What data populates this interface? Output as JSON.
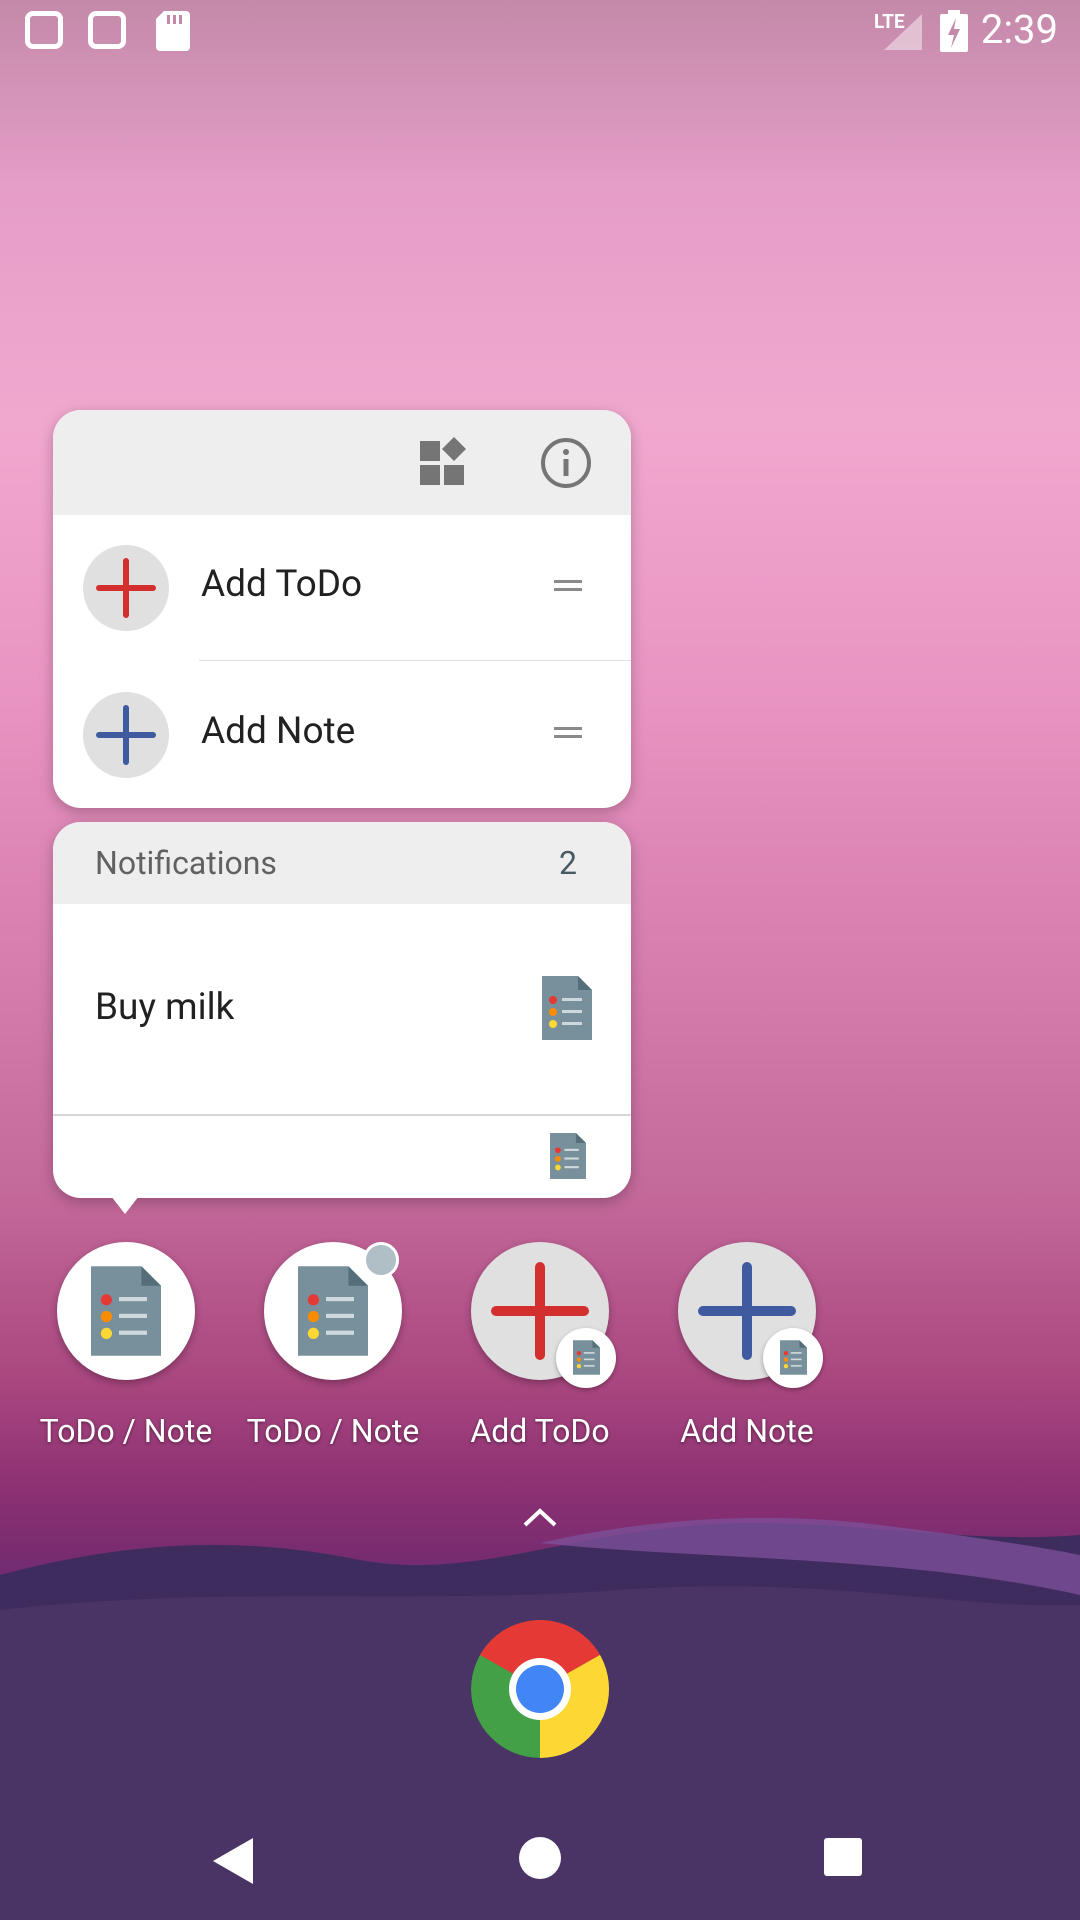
{
  "status_bar": {
    "time": "2:39",
    "network": "LTE",
    "left_icons": [
      "square-notification-icon",
      "square-notification-icon",
      "sd-card-icon"
    ],
    "right_icons": [
      "lte-signal-icon",
      "battery-charging-icon"
    ]
  },
  "shortcuts_popup": {
    "header_icons": [
      "widgets-icon",
      "app-info-icon"
    ],
    "items": [
      {
        "label": "Add ToDo",
        "icon": "plus-icon",
        "color": "#d32f2f"
      },
      {
        "label": "Add Note",
        "icon": "plus-icon",
        "color": "#3f5a9e"
      }
    ]
  },
  "notifications": {
    "title": "Notifications",
    "count": "2",
    "items": [
      {
        "text": "Buy milk",
        "icon": "todo-note-icon"
      }
    ],
    "footer_icon": "todo-note-icon"
  },
  "home_apps": [
    {
      "label": "ToDo / Note",
      "icon": "todo-note-icon"
    },
    {
      "label": "ToDo / Note",
      "icon": "todo-note-icon",
      "badge": "notification-dot"
    },
    {
      "label": "Add ToDo",
      "icon": "plus-icon",
      "color": "#d32f2f"
    },
    {
      "label": "Add Note",
      "icon": "plus-icon",
      "color": "#3f5a9e"
    }
  ],
  "dock": {
    "app": "chrome-icon"
  },
  "nav_bar": [
    "back-button",
    "home-button",
    "recents-button"
  ]
}
